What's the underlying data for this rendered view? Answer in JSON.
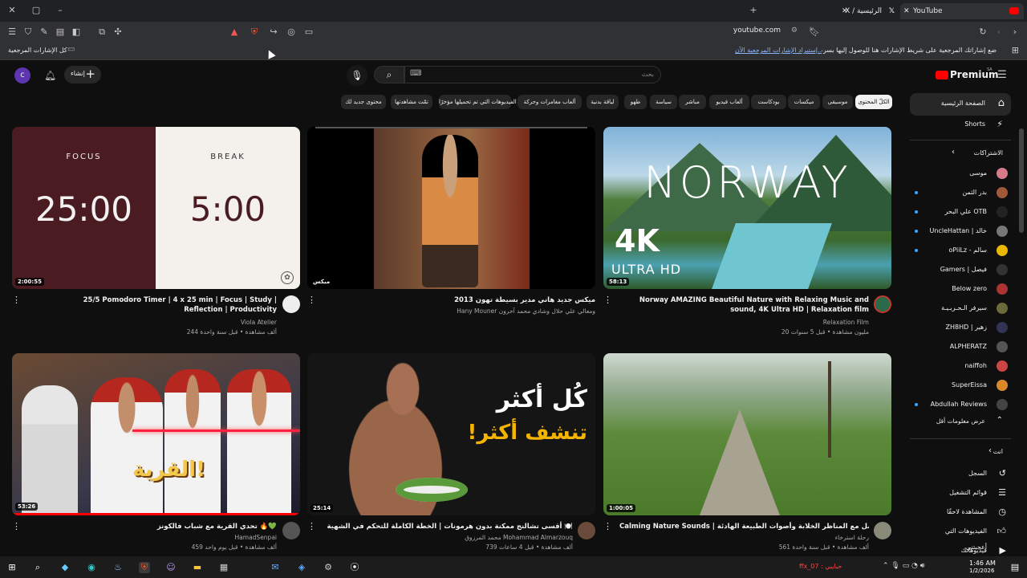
{
  "browser": {
    "tabs": [
      {
        "label": "YouTube"
      },
      {
        "label": "X / الرئيسية"
      }
    ],
    "url": "youtube.com",
    "bookmarks_all": "كل الإشارات المرجعية",
    "bookmarks_hint": "ضع إشاراتك المرجعية على شريط الإشارات هنا للوصول إليها بسرعة.",
    "bookmarks_import": "إستيراد الإشارات المرجعية الآن..."
  },
  "yt": {
    "logo": "Premium",
    "logo_region": "SA",
    "search_placeholder": "بحث",
    "create_label": "إنشاء",
    "avatar_letter": "c",
    "chips": [
      "الكلّ المحتوى",
      "موسيقى",
      "ميكسات",
      "بودكاست",
      "ألعاب فيديو",
      "مباشر",
      "سياسة",
      "طهو",
      "لياقة بدنية",
      "ألعاب مغامرات وحركة",
      "الفيديوهات التي تم تحميلها مؤخرًا",
      "تمّت مشاهدتها",
      "محتوى جديد لك"
    ],
    "sidebar": {
      "home": "الصفحة الرئيسية",
      "shorts": "Shorts",
      "subs_header": "الاشتراكات",
      "subs": [
        {
          "name": "موسى",
          "dot": false,
          "color": "#d67a8a"
        },
        {
          "name": "بدر الثمن",
          "dot": true,
          "color": "#a05a3a"
        },
        {
          "name": "علي البحر OTB",
          "dot": true,
          "color": "#222"
        },
        {
          "name": "UncleHattan | خالد",
          "dot": true,
          "color": "#777"
        },
        {
          "name": "oPiiLz - سالم",
          "dot": true,
          "color": "#e8b700"
        },
        {
          "name": "Gamers | فيصل",
          "dot": false,
          "color": "#333"
        },
        {
          "name": "Below zero",
          "dot": false,
          "color": "#a33"
        },
        {
          "name": "سیرفر الـحـربـيـة",
          "dot": false,
          "color": "#6a6a3a"
        },
        {
          "name": "ZH8HD | زهير",
          "dot": false,
          "color": "#335"
        },
        {
          "name": "ALPHERATZ",
          "dot": false,
          "color": "#555"
        },
        {
          "name": "naiffoh",
          "dot": false,
          "color": "#c44"
        },
        {
          "name": "SuperEissa",
          "dot": false,
          "color": "#d88a2a"
        },
        {
          "name": "Abdullah Reviews",
          "dot": true,
          "color": "#444"
        }
      ],
      "show_less": "عرض معلومات أقل",
      "you_header": "انت",
      "you_items": [
        "السجل",
        "قوائم التشغيل",
        "المشاهدة لاحقًا",
        "الفيديوهات التي أعجبتني",
        "فيديوهاتك"
      ]
    },
    "videos": [
      {
        "title": "25/5 Pomodoro Timer | 4 x 25 min | Focus | Study | Reflection | Productivity",
        "channel": "Viola Atelier",
        "meta": "244 ألف مشاهدة • قبل سنة واحدة",
        "duration": "2:00:55",
        "focus_label": "FOCUS",
        "focus_time": "25:00",
        "break_label": "BREAK",
        "break_time": "5:00"
      },
      {
        "title": "ميكس جديد هاني مدير بسيطة تهون 2013",
        "channel": "Hany Mouner ومعالي علي حلال وشادي محمد آخرون",
        "meta": "",
        "duration": "ميكس"
      },
      {
        "title": "Norway AMAZING Beautiful Nature with Relaxing Music and sound, 4K Ultra HD | Relaxation film",
        "channel": "Relaxation Film",
        "meta": "20 مليون مشاهدة • قبل 5 سنوات",
        "duration": "58:13",
        "thumb_title": "NORWAY",
        "thumb_4k": "4K",
        "thumb_uhd": "ULTRA HD"
      },
      {
        "title": "تحدي القرية مع شباب فالكونز 🔥💚",
        "channel": "HamadSenpai",
        "meta": "459 ألف مشاهدة • قبل يوم واحد",
        "duration": "53:26",
        "thumb_text": "القرية!"
      },
      {
        "title": "أقسى تشالنج ممكنة بدون هرمونات | الخطة الكاملة للتحكم في الشهية 🍽️",
        "channel": "محمد المرزوق Mohammad Almarzouq",
        "meta": "739 ألف مشاهدة • قبل 4 ساعات",
        "duration": "25:14",
        "thumb_line1": "كُل أكثر",
        "thumb_line2": "تنشف أكثر!"
      },
      {
        "title": "Calming Nature Sounds | استرخاء وتأمل مع المناظر الخلابة وأصوات الطبيعة الهادئة",
        "channel": "رحلة استرخاء",
        "meta": "561 ألف مشاهدة • قبل سنة واحدة",
        "duration": "1:00:05"
      }
    ]
  },
  "taskbar": {
    "user": "ffx_07 : حبايبي",
    "time": "1:46 AM",
    "date": "1/2/2026"
  }
}
